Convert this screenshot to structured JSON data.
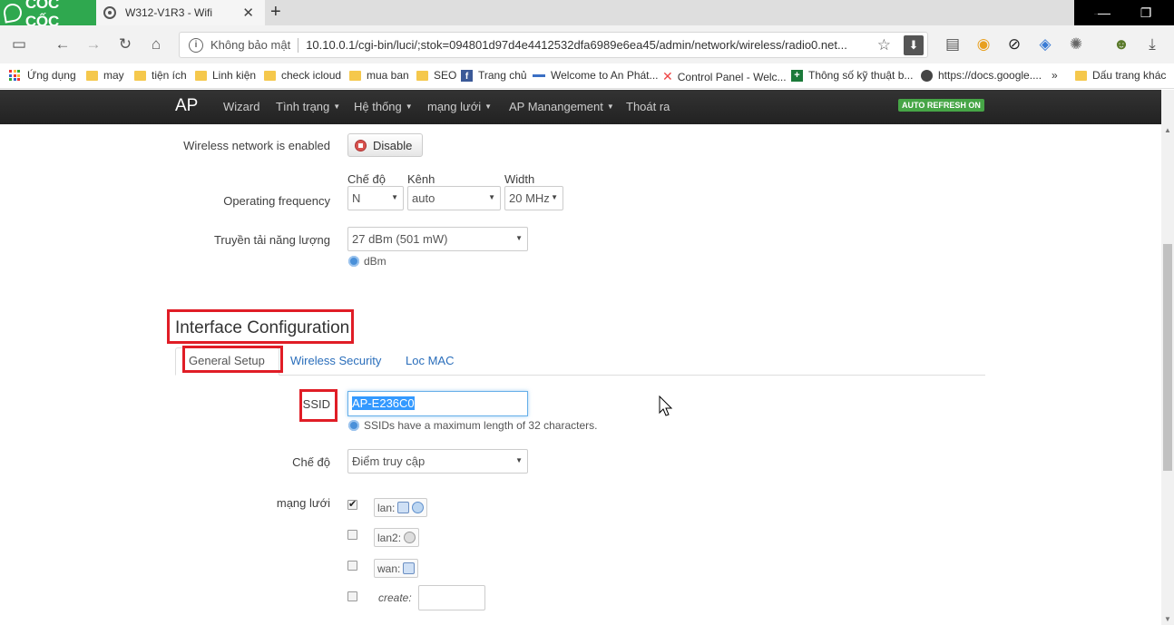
{
  "browser": {
    "brand": "CỐC CỐC",
    "tab_title": "W312-V1R3 - Wifi",
    "security_label": "Không bảo mật",
    "url": "10.10.0.1/cgi-bin/luci/;stok=094801d97d4e4412532dfa6989e6ea45/admin/network/wireless/radio0.net...",
    "bookmarks": [
      "Ứng dụng",
      "may",
      "tiện ích",
      "Linh kiện",
      "check icloud",
      "mua ban",
      "SEO",
      "Trang chủ",
      "Welcome to An Phát...",
      "Control Panel - Welc...",
      "Thông số kỹ thuật b...",
      "https://docs.google....",
      "»",
      "Dấu trang khác"
    ]
  },
  "nav": {
    "brand": "AP",
    "items": [
      "Wizard",
      "Tình trạng",
      "Hệ thống",
      "mạng lưới",
      "AP Manangement",
      "Thoát ra"
    ],
    "auto_refresh": "AUTO REFRESH ON"
  },
  "device": {
    "enabled_label": "Wireless network is enabled",
    "disable_button": "Disable",
    "freq_label": "Operating frequency",
    "mode_label": "Chế độ",
    "channel_label": "Kênh",
    "width_label": "Width",
    "mode_value": "N",
    "channel_value": "auto",
    "width_value": "20 MHz",
    "txpower_label": "Truyền tải năng lượng",
    "txpower_value": "27 dBm (501 mW)",
    "txpower_hint": "dBm"
  },
  "iface": {
    "title": "Interface Configuration",
    "tabs": [
      "General Setup",
      "Wireless Security",
      "Loc MAC"
    ],
    "ssid_label": "SSID",
    "ssid_value": "AP-E236C0",
    "ssid_hint": "SSIDs have a maximum length of 32 characters.",
    "mode_label": "Chế độ",
    "mode_value": "Điểm truy cập",
    "network_label": "mạng lưới",
    "networks": [
      {
        "name": "lan:",
        "checked": true
      },
      {
        "name": "lan2:",
        "checked": false
      },
      {
        "name": "wan:",
        "checked": false
      }
    ],
    "create_label": "create:"
  },
  "colors": {
    "highlight": "#e01d26",
    "link": "#2a6ebb",
    "navbar": "#252525",
    "auto_refresh": "#46a546",
    "logo_green": "#2fa84f"
  }
}
